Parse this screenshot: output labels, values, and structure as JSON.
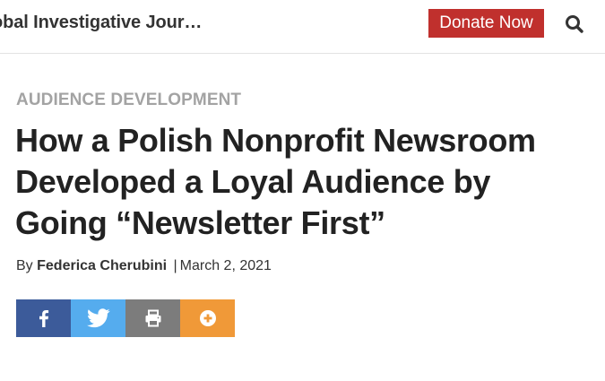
{
  "header": {
    "site_title": "obal Investigative Jour…",
    "donate_label": "Donate Now",
    "search_icon": "search-icon"
  },
  "article": {
    "category": "AUDIENCE DEVELOPMENT",
    "title_lines": [
      "How a Polish Nonprofit Newsroom",
      "Developed a Loyal Audience by",
      "Going “Newsletter First”"
    ],
    "byline": {
      "prefix": "By",
      "author": "Federica Cherubini",
      "separator": "|",
      "date": "March 2, 2021"
    }
  },
  "share": {
    "buttons": [
      {
        "icon": "facebook-icon",
        "color": "#3c5b9a"
      },
      {
        "icon": "twitter-icon",
        "color": "#55acee"
      },
      {
        "icon": "print-icon",
        "color": "#7c7c7c"
      },
      {
        "icon": "plus-circle-icon",
        "color": "#f09938"
      }
    ]
  },
  "colors": {
    "donate_bg": "#c0302d",
    "kicker_text": "#a3a3a3"
  }
}
